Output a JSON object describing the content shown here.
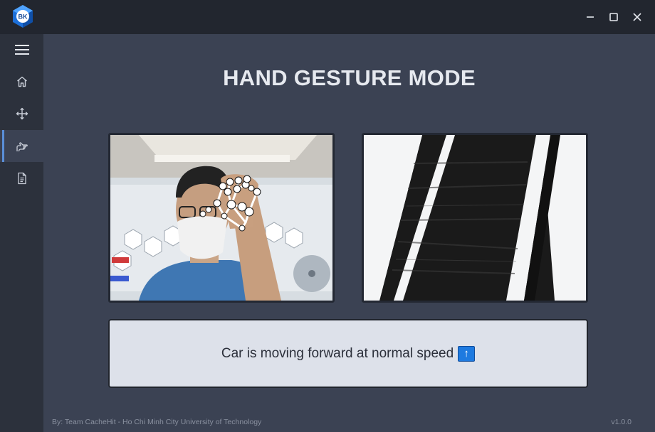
{
  "window": {
    "logo_text": "BK",
    "minimize_icon": "minimize-icon",
    "maximize_icon": "maximize-icon",
    "close_icon": "close-icon"
  },
  "sidebar": {
    "menu_icon": "hamburger-menu-icon",
    "items": [
      {
        "name": "home",
        "icon": "home-icon",
        "active": false
      },
      {
        "name": "move",
        "icon": "move-arrows-icon",
        "active": false
      },
      {
        "name": "hand-gesture",
        "icon": "hand-pointer-icon",
        "active": true
      },
      {
        "name": "document",
        "icon": "document-icon",
        "active": false
      }
    ]
  },
  "main": {
    "title": "HAND GESTURE MODE",
    "camera_feed": "camera-feed",
    "road_feed": "road-feed",
    "status": {
      "text": "Car is moving forward at normal speed",
      "emoji": "⬆️"
    }
  },
  "footer": {
    "credit": "By: Team CacheHit - Ho Chi Minh City University of Technology",
    "version": "v1.0.0"
  },
  "colors": {
    "titlebar": "#22262f",
    "sidebar": "#2c313c",
    "background": "#3b4253",
    "accent": "#5a8fd8",
    "status_box": "#dde1ea"
  }
}
